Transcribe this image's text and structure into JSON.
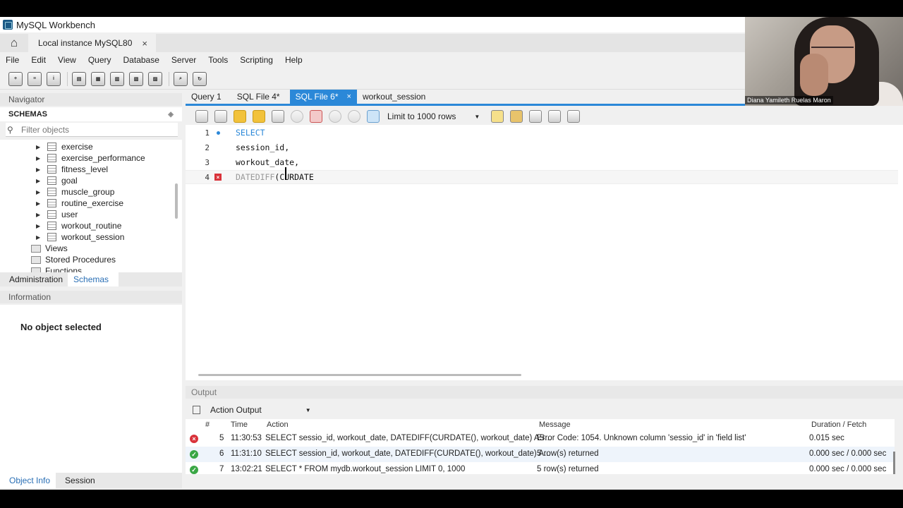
{
  "window": {
    "title": "MySQL Workbench"
  },
  "connection_tab": {
    "label": "Local instance MySQL80",
    "close": "×"
  },
  "menu": [
    "File",
    "Edit",
    "View",
    "Query",
    "Database",
    "Server",
    "Tools",
    "Scripting",
    "Help"
  ],
  "navigator": {
    "header": "Navigator",
    "schemas_label": "SCHEMAS",
    "filter_placeholder": "Filter objects",
    "tables": [
      "exercise",
      "exercise_performance",
      "fitness_level",
      "goal",
      "muscle_group",
      "routine_exercise",
      "user",
      "workout_routine",
      "workout_session"
    ],
    "groups": [
      "Views",
      "Stored Procedures",
      "Functions"
    ]
  },
  "left_tabs": {
    "administration": "Administration",
    "schemas": "Schemas"
  },
  "information": {
    "header": "Information",
    "empty": "No object selected"
  },
  "bottom_tabs": {
    "object_info": "Object Info",
    "session": "Session"
  },
  "editor_tabs": [
    {
      "label": "Query 1"
    },
    {
      "label": "SQL File 4*"
    },
    {
      "label": "SQL File 6*",
      "active": true,
      "close": "×"
    },
    {
      "label": "workout_session"
    }
  ],
  "editor_toolbar": {
    "limit": "Limit to 1000 rows"
  },
  "editor": {
    "lines": [
      {
        "n": "1",
        "text": "SELECT"
      },
      {
        "n": "2",
        "text": "session_id,"
      },
      {
        "n": "3",
        "text": "workout_date,"
      },
      {
        "n": "4",
        "text_a": "DATEDIFF",
        "text_b": "(CURDATE"
      }
    ]
  },
  "output": {
    "header": "Output",
    "selector": "Action Output",
    "columns": {
      "num": "#",
      "time": "Time",
      "action": "Action",
      "message": "Message",
      "duration": "Duration / Fetch"
    },
    "rows": [
      {
        "status": "error",
        "num": "5",
        "time": "11:30:53",
        "action": "SELECT sessio_id, workout_date, DATEDIFF(CURDATE(), workout_date) AS...",
        "message": "Error Code: 1054. Unknown column 'sessio_id' in 'field list'",
        "duration": "0.015 sec"
      },
      {
        "status": "ok",
        "num": "6",
        "time": "11:31:10",
        "action": "SELECT session_id, workout_date, DATEDIFF(CURDATE(), workout_date) A...",
        "message": "5 row(s) returned",
        "duration": "0.000 sec / 0.000 sec"
      },
      {
        "status": "ok",
        "num": "7",
        "time": "13:02:21",
        "action": "SELECT * FROM mydb.workout_session LIMIT 0, 1000",
        "message": "5 row(s) returned",
        "duration": "0.000 sec / 0.000 sec"
      }
    ]
  },
  "webcam": {
    "name": "Diana Yamileth Ruelas Maron"
  },
  "colors": {
    "accent": "#2b88d8",
    "error": "#d9323a",
    "ok": "#3aa745"
  }
}
